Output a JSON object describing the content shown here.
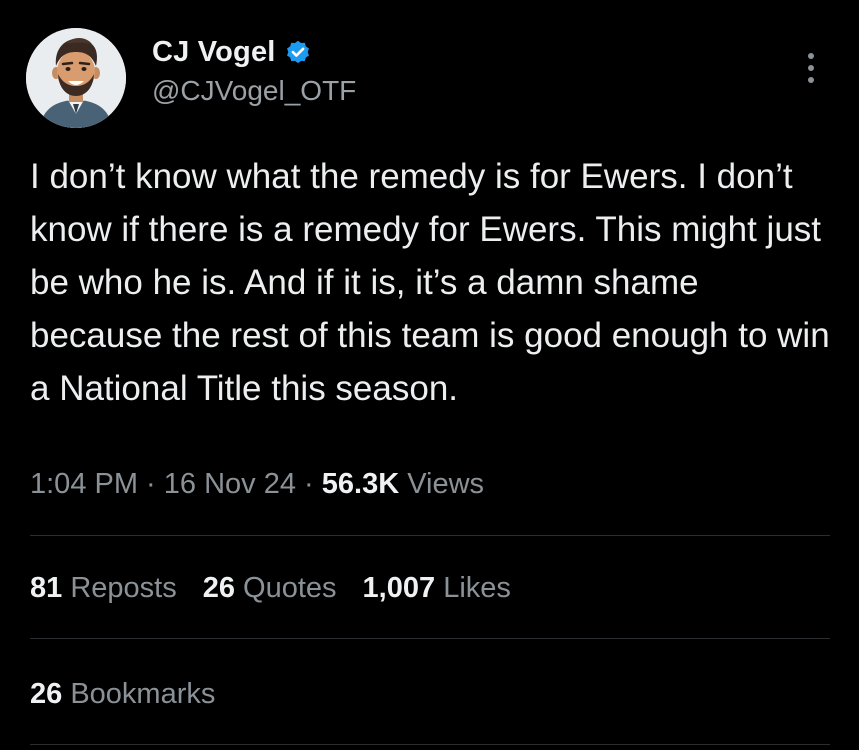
{
  "author": {
    "display_name": "CJ Vogel",
    "handle": "@CJVogel_OTF",
    "verified_icon": "verified-badge-icon",
    "avatar": "cartoon-avatar"
  },
  "tweet": {
    "text": "I don’t know what the remedy is for Ewers. I don’t know if there is a remedy for Ewers. This might just be who he is. And if it is, it’s a damn shame because the rest of this team is good enough to win a National Title this season."
  },
  "meta": {
    "time": "1:04 PM",
    "separator": " · ",
    "date": "16 Nov 24",
    "views_count": "56.3K",
    "views_label": "Views"
  },
  "stats": {
    "reposts_count": "81",
    "reposts_label": "Reposts",
    "quotes_count": "26",
    "quotes_label": "Quotes",
    "likes_count": "1,007",
    "likes_label": "Likes",
    "bookmarks_count": "26",
    "bookmarks_label": "Bookmarks"
  },
  "colors": {
    "background": "#000000",
    "text_primary": "#e7e9ea",
    "text_secondary": "#8b9297",
    "verified_blue": "#1d9bf0",
    "divider": "#2a2e31"
  }
}
